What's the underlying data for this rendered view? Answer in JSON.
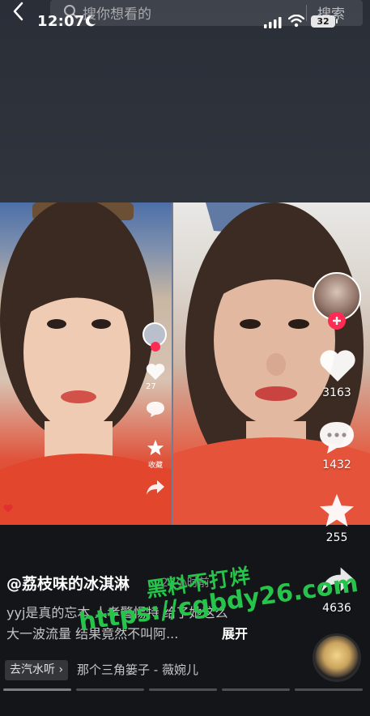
{
  "status_bar": {
    "time": "12:07",
    "battery": "32"
  },
  "search": {
    "placeholder": "搜你想看的",
    "button_label": "搜索"
  },
  "actions": {
    "like_count": "3163",
    "comment_count": "1432",
    "favorite_count": "255",
    "share_count": "4636"
  },
  "inner_video": {
    "like_count": "27",
    "favorite_label": "收藏"
  },
  "post": {
    "author": "@荔枝味的冰淇淋",
    "time": "· 23小时前",
    "caption_line1": "yyj是真的忘本 人孝警惕特 给了她这么",
    "caption_line2": "大一波流量 结果竟然不叫阿...",
    "expand_label": "展开"
  },
  "music": {
    "tag": "去汽水听 ›",
    "title": "那个三角篓子 - 薇婉儿"
  },
  "watermark": {
    "line1": "黑料不打烊",
    "line2": "https://cgbdy26.com"
  },
  "colors": {
    "accent_red": "#fe2c55",
    "watermark_green": "#26c44a",
    "background": "#141519"
  },
  "icons": [
    "back-icon",
    "search-icon",
    "moon-icon",
    "signal-icon",
    "wifi-icon",
    "heart-icon",
    "comment-icon",
    "star-icon",
    "share-icon",
    "plus-icon"
  ]
}
